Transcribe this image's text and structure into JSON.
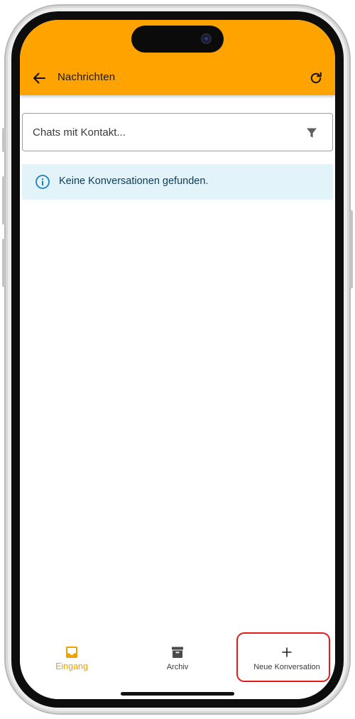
{
  "header": {
    "title": "Nachrichten",
    "background_color": "#ffa300",
    "back_icon": "arrow-left-icon",
    "refresh_icon": "refresh-icon"
  },
  "search": {
    "placeholder": "Chats mit Kontakt...",
    "value": "",
    "filter_icon": "filter-icon"
  },
  "info_alert": {
    "message": "Keine Konversationen gefunden.",
    "icon": "info-icon",
    "background_color": "#e3f3fa"
  },
  "bottom_nav": {
    "active_color": "#f5a000",
    "items": [
      {
        "label": "Eingang",
        "icon": "inbox-icon",
        "active": true
      },
      {
        "label": "Archiv",
        "icon": "archive-icon",
        "active": false
      },
      {
        "label": "Neue Konversation",
        "icon": "plus-icon",
        "active": false
      }
    ],
    "highlight_color": "#e31b1b"
  }
}
